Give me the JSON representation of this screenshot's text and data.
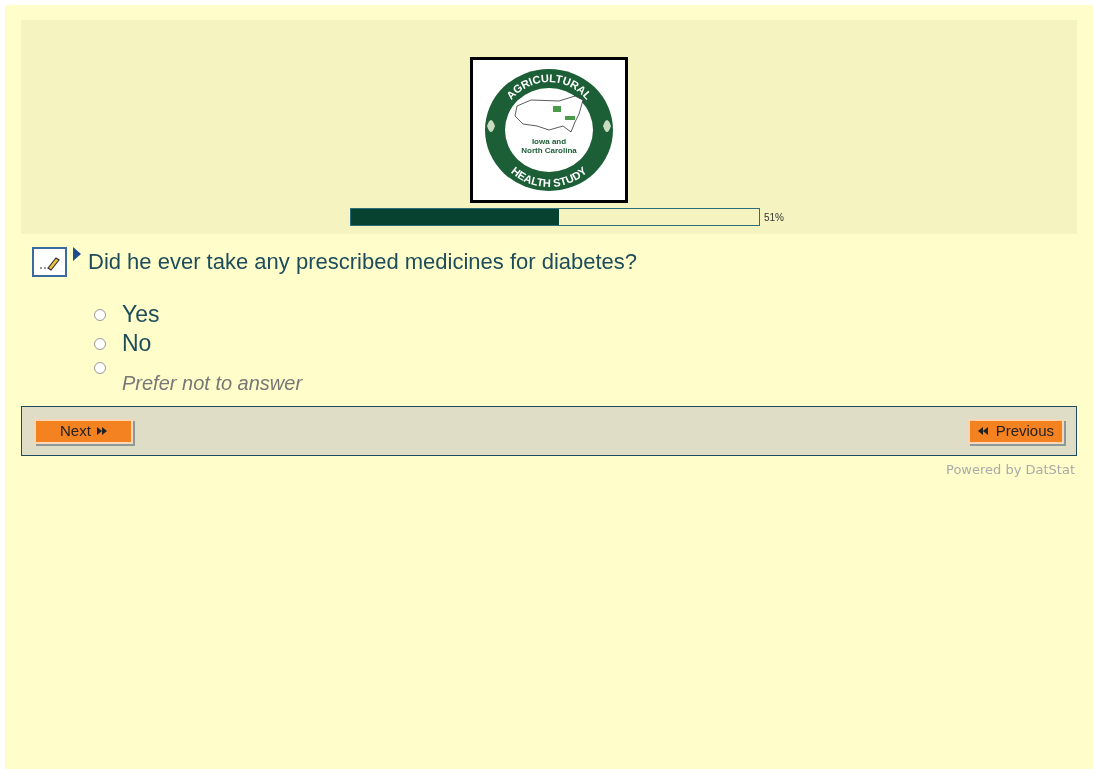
{
  "logo": {
    "top_text": "AGRICULTURAL",
    "bottom_text": "HEALTH STUDY",
    "inner_text": [
      "Iowa and",
      "North Carolina"
    ]
  },
  "progress": {
    "level": 0.51,
    "reading": "51%"
  },
  "question": {
    "text": "Did he ever take any prescribed medicines for diabetes?"
  },
  "options": [
    {
      "label": "Yes",
      "kind": "answer",
      "selected": false
    },
    {
      "label": "No",
      "kind": "answer",
      "selected": false
    },
    {
      "label": "Prefer not to answer",
      "kind": "opt_out",
      "selected": false
    }
  ],
  "nav": {
    "next": "Next",
    "previous": "Previous"
  },
  "footer": "Powered by DatStat"
}
